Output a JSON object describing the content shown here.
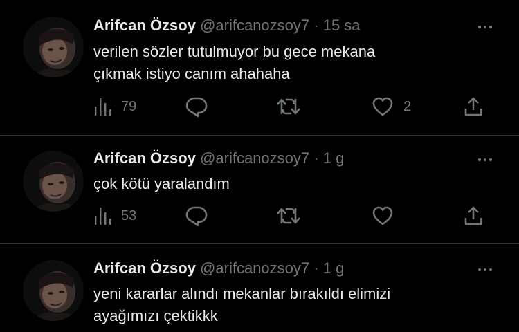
{
  "tweets": [
    {
      "name": "Arifcan Özsoy",
      "handle": "@arifcanozsoy7",
      "separator": "·",
      "time": "15 sa",
      "text": "verilen sözler tutulmuyor bu gece mekana\nçıkmak istiyo canım ahahaha",
      "views": "79",
      "likes": "2",
      "avatar_icon": "profile-photo"
    },
    {
      "name": "Arifcan Özsoy",
      "handle": "@arifcanozsoy7",
      "separator": "·",
      "time": "1 g",
      "text": "çok kötü yaralandım",
      "views": "53",
      "likes": "",
      "avatar_icon": "profile-photo"
    },
    {
      "name": "Arifcan Özsoy",
      "handle": "@arifcanozsoy7",
      "separator": "·",
      "time": "1 g",
      "text": "yeni kararlar alındı mekanlar bırakıldı elimizi\nayağımızı çektikkk",
      "views": "",
      "likes": "",
      "avatar_icon": "profile-photo"
    }
  ],
  "icons": {
    "views": "views-chart-icon",
    "reply": "reply-icon",
    "retweet": "retweet-icon",
    "like": "heart-icon",
    "share": "share-icon",
    "more": "more-dots-icon"
  },
  "colors": {
    "background": "#000000",
    "primary_text": "#e7e9ea",
    "secondary_text": "#71767b",
    "divider": "#2f3336"
  }
}
